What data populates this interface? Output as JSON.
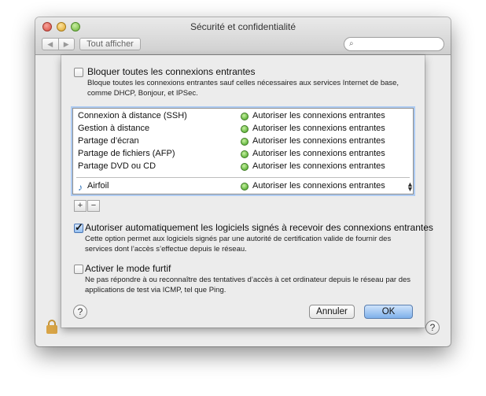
{
  "window": {
    "title": "Sécurité et confidentialité",
    "back_label": "◀",
    "forward_label": "▶",
    "show_all_label": "Tout afficher",
    "search_placeholder": "",
    "search_icon": "magnifier-icon",
    "help_label": "?"
  },
  "sheet": {
    "block_all": {
      "checked": false,
      "label": "Bloquer toutes les connexions entrantes",
      "description": "Bloque toutes les connexions entrantes sauf celles nécessaires aux services Internet de base, comme DHCP, Bonjour, et IPSec."
    },
    "services": [
      {
        "name": "Connexion à distance (SSH)",
        "status": "Autoriser les connexions entrantes"
      },
      {
        "name": "Gestion à distance",
        "status": "Autoriser les connexions entrantes"
      },
      {
        "name": "Partage d’écran",
        "status": "Autoriser les connexions entrantes"
      },
      {
        "name": "Partage de fichiers (AFP)",
        "status": "Autoriser les connexions entrantes"
      },
      {
        "name": "Partage DVD ou CD",
        "status": "Autoriser les connexions entrantes"
      }
    ],
    "app": {
      "name": "Airfoil",
      "status": "Autoriser les connexions entrantes",
      "icon": "music-note-icon"
    },
    "add_label": "+",
    "remove_label": "−",
    "signed": {
      "checked": true,
      "label": "Autoriser automatiquement les logiciels signés à recevoir des connexions entrantes",
      "description": "Cette option permet aux logiciels signés par une autorité de certification valide de fournir des services dont l’accès s’effectue depuis le réseau."
    },
    "stealth": {
      "checked": false,
      "label": "Activer le mode furtif",
      "description": "Ne pas répondre à ou reconnaître des tentatives d’accès à cet ordinateur depuis le réseau par des applications de test via ICMP, tel que Ping."
    },
    "help_label": "?",
    "cancel_label": "Annuler",
    "ok_label": "OK"
  },
  "colors": {
    "status_green": "#3fa21c",
    "default_button": "#7fb0ea",
    "list_focus": "#aecbf2"
  }
}
